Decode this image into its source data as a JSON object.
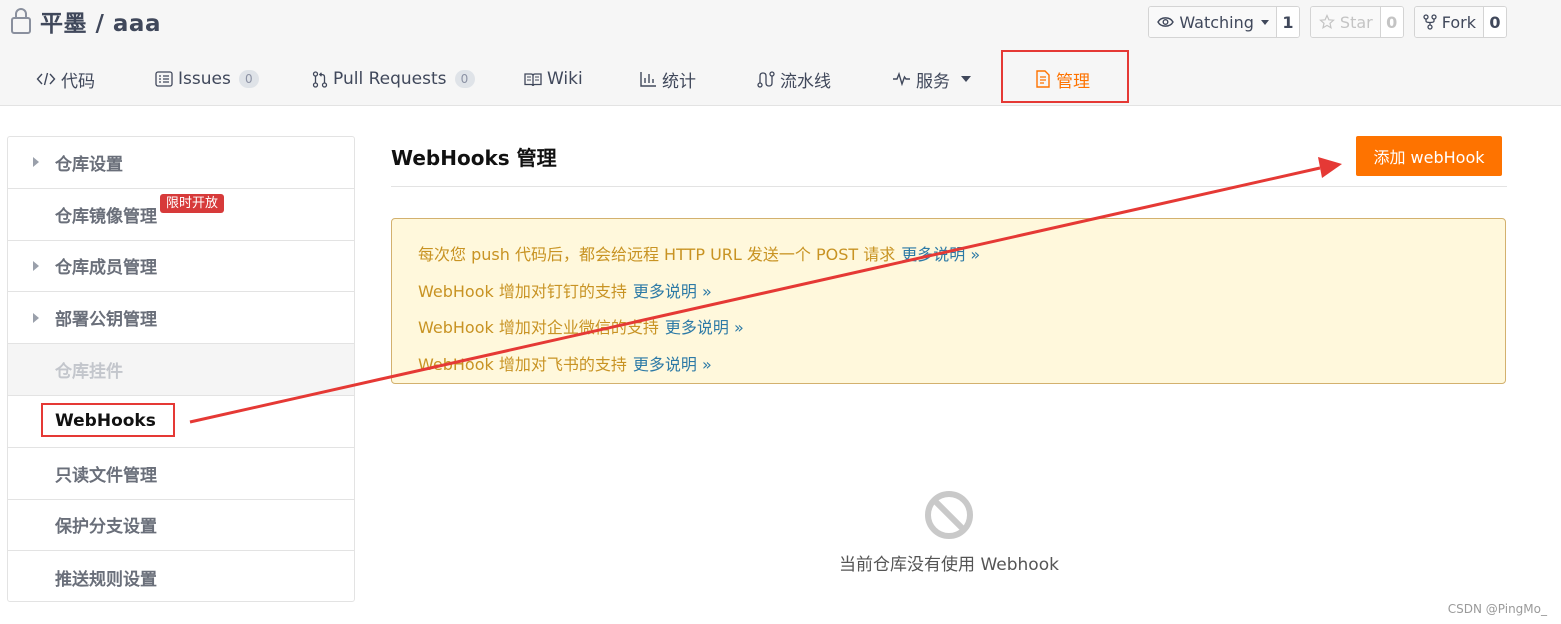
{
  "repo": {
    "title": "平墨 / aaa"
  },
  "actions": {
    "watch": {
      "label": "Watching",
      "count": "1"
    },
    "star": {
      "label": "Star",
      "count": "0"
    },
    "fork": {
      "label": "Fork",
      "count": "0"
    }
  },
  "tabs": [
    {
      "label": "代码",
      "icon": "code-icon"
    },
    {
      "label": "Issues",
      "badge": "0",
      "icon": "issues-icon"
    },
    {
      "label": "Pull Requests",
      "badge": "0",
      "icon": "pull-request-icon"
    },
    {
      "label": "Wiki",
      "icon": "wiki-icon"
    },
    {
      "label": "统计",
      "icon": "stats-icon"
    },
    {
      "label": "流水线",
      "icon": "pipeline-icon"
    },
    {
      "label": "服务",
      "icon": "activity-icon"
    },
    {
      "label": "管理",
      "icon": "manage-icon",
      "active": true
    }
  ],
  "sidebar": {
    "items": [
      {
        "label": "仓库设置"
      },
      {
        "label": "仓库镜像管理",
        "badge": "限时开放"
      },
      {
        "label": "仓库成员管理"
      },
      {
        "label": "部署公钥管理"
      },
      {
        "label": "仓库挂件"
      },
      {
        "label": "WebHooks"
      },
      {
        "label": "只读文件管理"
      },
      {
        "label": "保护分支设置"
      },
      {
        "label": "推送规则设置"
      }
    ]
  },
  "main": {
    "title": "WebHooks 管理",
    "add_button": "添加 webHook",
    "notice": [
      {
        "text": "每次您 push 代码后，都会给远程 HTTP URL 发送一个 POST 请求",
        "more": "更多说明 »"
      },
      {
        "text": "WebHook 增加对钉钉的支持",
        "more": "更多说明 »"
      },
      {
        "text": "WebHook 增加对企业微信的支持",
        "more": "更多说明 »"
      },
      {
        "text": "WebHook 增加对飞书的支持",
        "more": "更多说明 »"
      }
    ],
    "empty_message": "当前仓库没有使用 Webhook"
  },
  "watermark": "CSDN @PingMo_",
  "colors": {
    "accent": "#fe7300",
    "annotation": "#e53935",
    "notice_text": "#c89323",
    "link": "#2d7aa6"
  }
}
